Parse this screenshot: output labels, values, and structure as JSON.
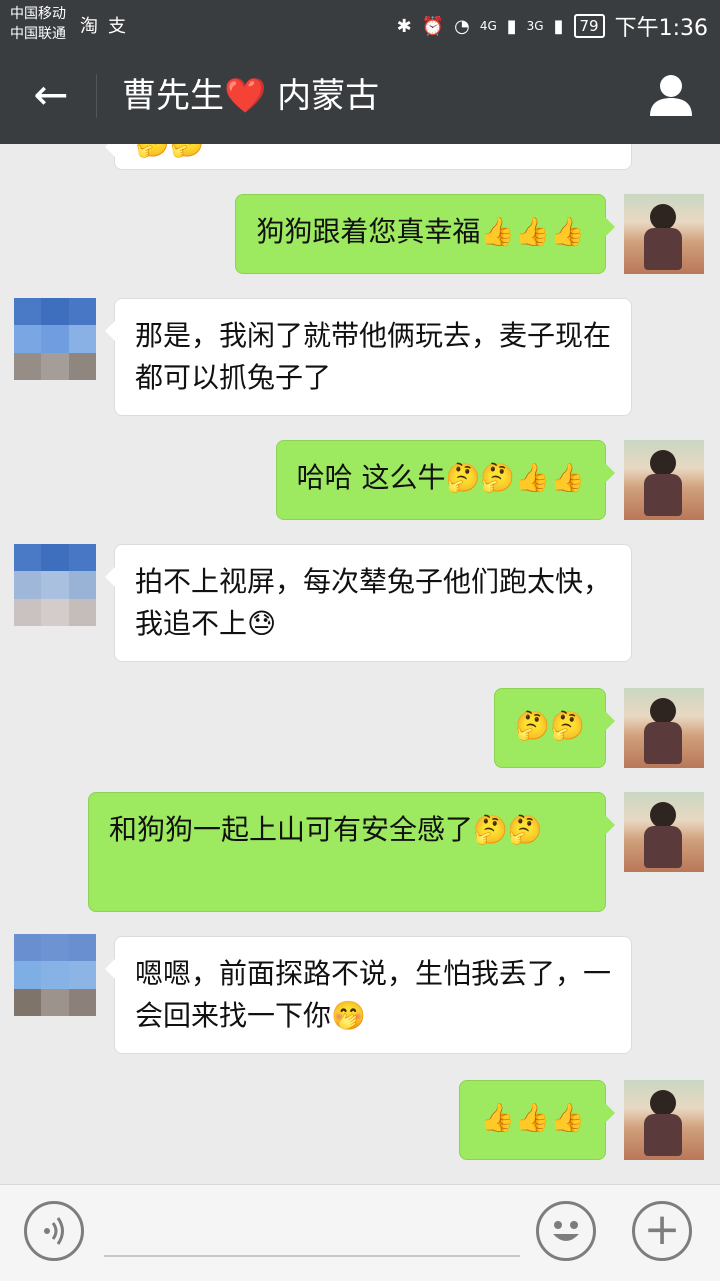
{
  "status_bar": {
    "carrier_1": "中国移动",
    "carrier_2": "中国联通",
    "app_icons": [
      "淘",
      "支"
    ],
    "network_1": "4G",
    "network_2": "3G",
    "battery": "79",
    "time": "下午1:36"
  },
  "header": {
    "back_icon": "←",
    "title": "曹先生❤️ 内蒙古",
    "profile_icon": "person-icon"
  },
  "messages": [
    {
      "side": "left",
      "text": "🤔🤔"
    },
    {
      "side": "right",
      "text": "狗狗跟着您真幸福👍👍👍"
    },
    {
      "side": "left",
      "text": "那是，我闲了就带他俩玩去，麦子现在都可以抓兔子了"
    },
    {
      "side": "right",
      "text": "哈哈 这么牛🤔🤔👍👍"
    },
    {
      "side": "left",
      "text": "拍不上视屏，每次辇兔子他们跑太快，我追不上😓"
    },
    {
      "side": "right",
      "text": "🤔🤔"
    },
    {
      "side": "right",
      "text": "和狗狗一起上山可有安全感了🤔🤔"
    },
    {
      "side": "left",
      "text": "嗯嗯，前面探路不说，生怕我丢了，一会回来找一下你🤭"
    },
    {
      "side": "right",
      "text": "👍👍👍"
    }
  ],
  "input_bar": {
    "voice_icon": "voice-icon",
    "emoji_icon": "emoji-icon",
    "plus_icon": "+"
  },
  "colors": {
    "header_bg": "#3a3d40",
    "chat_bg": "#ebebeb",
    "bubble_right": "#9de95f",
    "bubble_left": "#ffffff"
  }
}
